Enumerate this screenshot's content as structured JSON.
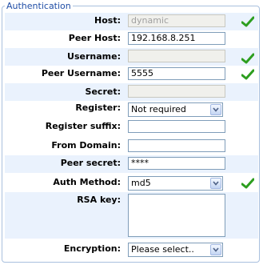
{
  "section": {
    "title": "Authentication"
  },
  "fields": {
    "host": {
      "label": "Host:",
      "placeholder": "dynamic",
      "valid": true
    },
    "peer_host": {
      "label": "Peer Host:",
      "value": "192.168.8.251"
    },
    "username": {
      "label": "Username:",
      "value": "",
      "valid": true
    },
    "peer_username": {
      "label": "Peer Username:",
      "value": "5555",
      "valid": true
    },
    "secret": {
      "label": "Secret:",
      "value": ""
    },
    "register": {
      "label": "Register:",
      "selected": "Not required"
    },
    "register_suffix": {
      "label": "Register suffix:",
      "value": ""
    },
    "from_domain": {
      "label": "From Domain:",
      "value": ""
    },
    "peer_secret": {
      "label": "Peer secret:",
      "value": "****"
    },
    "auth_method": {
      "label": "Auth Method:",
      "selected": "md5",
      "valid": true
    },
    "rsa_key": {
      "label": "RSA key:",
      "value": ""
    },
    "encryption": {
      "label": "Encryption:",
      "selected": "Please select.."
    }
  },
  "colors": {
    "legend_text": "#1f4da6",
    "row_highlight": "#eaf2fd",
    "frame_border": "#a9c0de",
    "check_green": "#2d9e1f"
  },
  "icons": {
    "valid": "checkmark-icon",
    "dropdown": "chevron-down-icon"
  }
}
